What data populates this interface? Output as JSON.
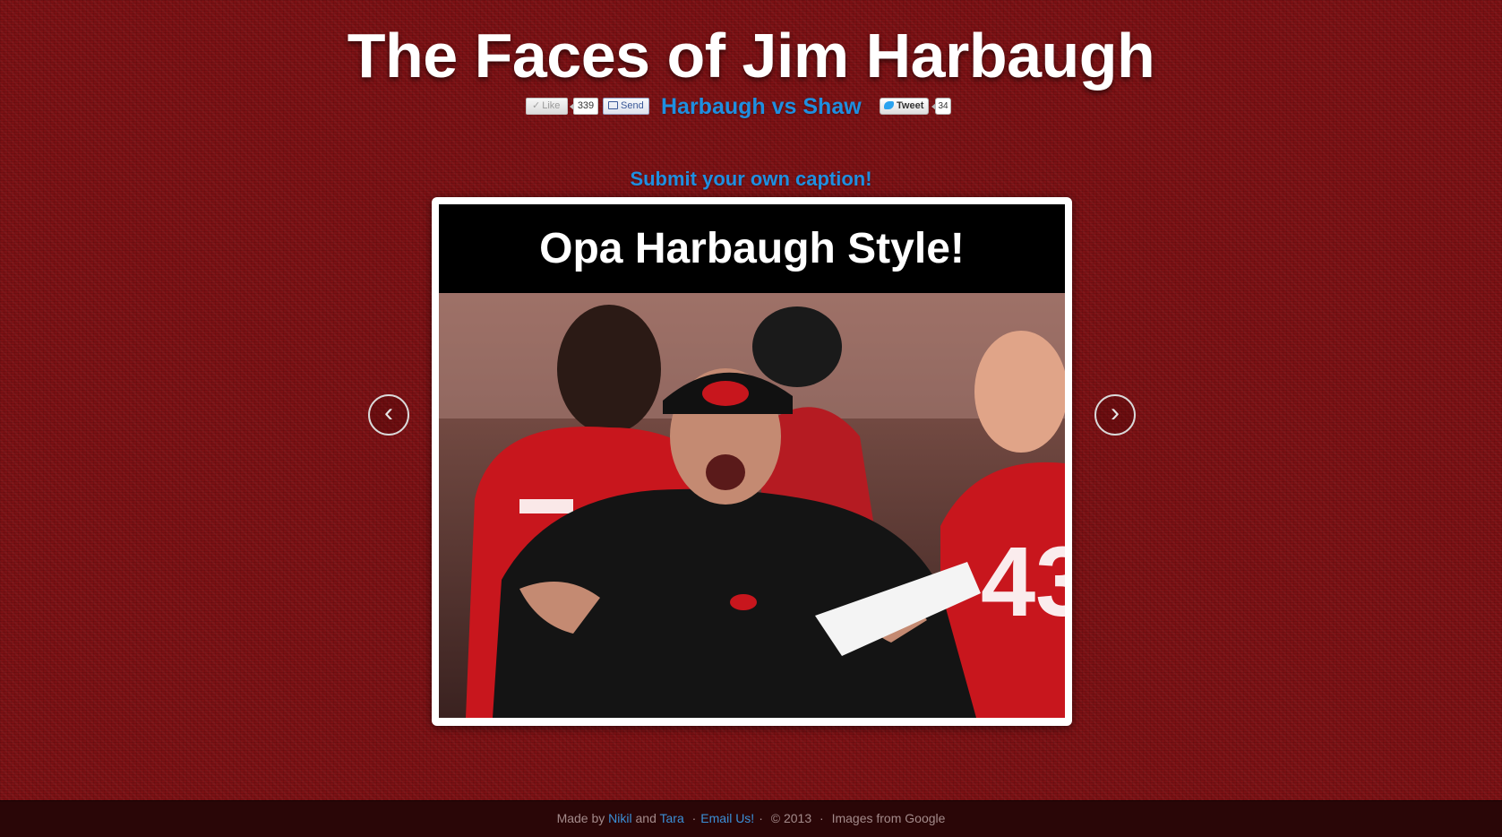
{
  "header": {
    "title": "The Faces of Jim Harbaugh",
    "vs_link": "Harbaugh vs Shaw"
  },
  "social": {
    "like_label": "Like",
    "like_count": "339",
    "send_label": "Send",
    "tweet_label": "Tweet",
    "tweet_count": "34"
  },
  "main": {
    "submit_link": "Submit your own caption!",
    "caption": "Opa Harbaugh Style!",
    "prev_arrow": "‹",
    "next_arrow": "›"
  },
  "footer": {
    "made_by": "Made by",
    "author1": "Nikil",
    "and": "and",
    "author2": "Tara",
    "email_link": "Email Us!",
    "copyright": "© 2013",
    "images_credit": "Images from Google",
    "dot": "·"
  },
  "colors": {
    "background": "#7c1114",
    "link": "#1f8fe0",
    "footer_bg": "#2a0607"
  },
  "icons": [
    "checkmark-icon",
    "speech-bubble-icon",
    "twitter-bird-icon",
    "chevron-left-icon",
    "chevron-right-icon"
  ]
}
